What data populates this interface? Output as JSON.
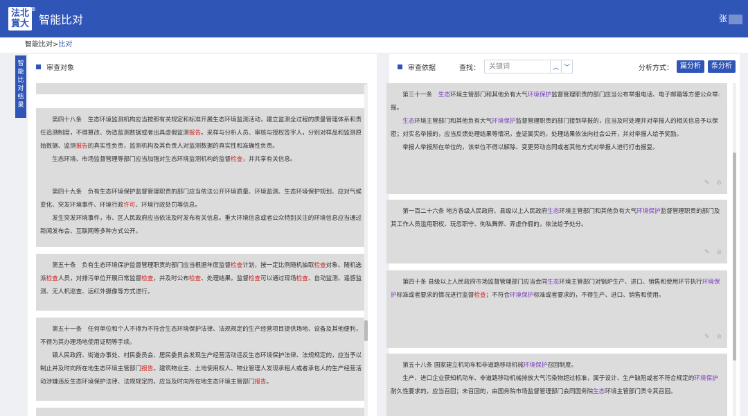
{
  "header": {
    "logo": [
      "法北",
      "賞大"
    ],
    "logo_mark": "®",
    "title": "智能比对",
    "user": "张"
  },
  "breadcrumb": {
    "root": "智能比对",
    "sep": ">",
    "current": "比对"
  },
  "side_tab": "智能比对结果",
  "left": {
    "heading": "审查对象",
    "cards": [
      {
        "paras": [
          [
            [
              "第四十八条　生态环境监测机构应当按照有关规定和标准开展生态环境监测活动，建立监测全过程的质量管理体系和责任追溯制度，不得篡改、伪造监测数据或者出具虚假监测",
              ""
            ],
            [
              "报告",
              "r"
            ],
            [
              "。采样与分析人员、审核与授权签字人，分别对样品和监测原始数据、监测",
              ""
            ],
            [
              "报告",
              "r"
            ],
            [
              "的真实性负责，监测机构及其负责人对监测数据的真实性和准确性负责。",
              ""
            ]
          ],
          [
            [
              "生态环境、市场监督管理等部门应当加强对生态环境监测机构的监督",
              ""
            ],
            [
              "检查",
              "r"
            ],
            [
              "，并共享有关信息。",
              ""
            ]
          ]
        ]
      },
      {
        "paras": [
          [
            [
              "第四十九条　负有生态环境保护监督管理职责的部门应当依法公开环境质量、环境监测、生态环境保护规划、应对气候变化、突发环境事件、环境行政",
              ""
            ],
            [
              "许可",
              "r"
            ],
            [
              "、环境行政处罚等信息。",
              ""
            ]
          ],
          [
            [
              "发生突发环境事件，市、区人民政府应当依法及时发布有关信息。重大环境信息或者公众特别关注的环境信息应当通过新闻发布会、互联网等多种方式公开。",
              ""
            ]
          ]
        ]
      },
      {
        "paras": [
          [
            [
              "第五十条　负有生态环境保护监督管理职责的部门应当根据年度监督",
              ""
            ],
            [
              "检查",
              "r"
            ],
            [
              "计划，按一定比例随机抽取",
              ""
            ],
            [
              "检查",
              "r"
            ],
            [
              "对象、随机选派",
              ""
            ],
            [
              "检查",
              "r"
            ],
            [
              "人员，对排污单位开展日常监督",
              ""
            ],
            [
              "检查",
              "r"
            ],
            [
              "，并及时公布",
              ""
            ],
            [
              "检查",
              "r"
            ],
            [
              "、处理结果。监督",
              ""
            ],
            [
              "检查",
              "r"
            ],
            [
              "可以通过现场",
              ""
            ],
            [
              "检查",
              "r"
            ],
            [
              "、自动监测、遥感监测、无人机巡查、远红外摄像等方式进行。",
              ""
            ]
          ]
        ]
      },
      {
        "paras": [
          [
            [
              "第五十一条　任何单位和个人不得为不符合生态环境保护法律、法规规定的生产经营项目提供场地、设备及其他便利，不得为其办理场地使用证明等手续。",
              ""
            ]
          ],
          [
            [
              "镇人民政府、街道办事处、村民委员会、居民委员会发现生产经营活动违反生态环境保护法律、法规规定的，应当予以制止并及时向所在地生态环境主管部门",
              ""
            ],
            [
              "报告",
              "r"
            ],
            [
              "。建筑物业主、土地使用权人、物业管理人发现承租人或者承包人的生产经营活动涉嫌违反生态环境保护法律、法规规定的，应当及时向所在地生态环境主管部门",
              ""
            ],
            [
              "报告",
              "r"
            ],
            [
              "。",
              ""
            ]
          ]
        ]
      }
    ]
  },
  "right": {
    "heading": "审查依据",
    "search_label": "查找：",
    "search_placeholder": "关键词",
    "analysis_label": "分析方式：",
    "btn_article": "篇分析",
    "btn_clause": "条分析",
    "cards": [
      {
        "paras": [
          [
            [
              "第三十一条　",
              ""
            ],
            [
              "生态",
              "p"
            ],
            [
              "环境主管部门和其他负有大气",
              ""
            ],
            [
              "环境保护",
              "p"
            ],
            [
              "监督管理职责的部门应当公布举报电话、电子邮箱等方便公众举报。",
              ""
            ]
          ],
          [
            [
              "生态",
              "p"
            ],
            [
              "环境主管部门和其他负有大气",
              ""
            ],
            [
              "环境保护",
              "p"
            ],
            [
              "监督管理职责的部门接到举报的，应当及时处理并对举报人的相关信息予以保密；对实名举报的，应当反馈处理结果等情况，查证属实的，处理结果依法向社会公开，并对举报人给予奖励。",
              ""
            ]
          ],
          [
            [
              "举报人举报所在单位的，该单位不得以解除、变更劳动合同或者其他方式对举报人进行打击报复。",
              ""
            ]
          ]
        ]
      },
      {
        "paras": [
          [
            [
              "第一百二十六条 地方各级人民政府、县级以上人民政府",
              ""
            ],
            [
              "生态",
              "p"
            ],
            [
              "环境主管部门和其他负有大气",
              ""
            ],
            [
              "环境保护",
              "p"
            ],
            [
              "监督管理职责的部门及其工作人员滥用职权、玩忽职守、徇私舞弊、弄虚作假的，依法给予处分。",
              ""
            ]
          ]
        ]
      },
      {
        "paras": [
          [
            [
              "第四十条 县级以上人民政府市场监督管理部门应当会同",
              ""
            ],
            [
              "生态",
              "p"
            ],
            [
              "环境主管部门对锅炉生产、进口、销售和使用环节执行",
              ""
            ],
            [
              "环境保护",
              "p"
            ],
            [
              "标准或者要求的情况进行监督",
              ""
            ],
            [
              "检查",
              "r"
            ],
            [
              "；不符合",
              ""
            ],
            [
              "环境保护",
              "p"
            ],
            [
              "标准或者要求的，不得生产、进口、销售和使用。",
              ""
            ]
          ]
        ]
      },
      {
        "paras": [
          [
            [
              "第五十八条 国家建立机动车和非道路移动机械",
              ""
            ],
            [
              "环境保护",
              "p"
            ],
            [
              "召回制度。",
              ""
            ]
          ],
          [
            [
              "生产、进口企业获知机动车、非道路移动机械排放大气污染物超过标准，属于设计、生产缺陷或者不符合规定的",
              ""
            ],
            [
              "环境保护",
              "p"
            ],
            [
              "耐久性要求的，应当召回；未召回的，由国务院市场监督管理部门会同国务院",
              ""
            ],
            [
              "生态",
              "p"
            ],
            [
              "环境主管部门责令其召回。",
              ""
            ]
          ]
        ]
      }
    ]
  },
  "icons": {
    "edit": "pencil-icon",
    "check": "check-circle-icon",
    "close": "close-icon"
  },
  "colors": {
    "brand": "#2f55b7",
    "highlight_red": "#d0231f",
    "highlight_purple": "#7a3fbe"
  }
}
